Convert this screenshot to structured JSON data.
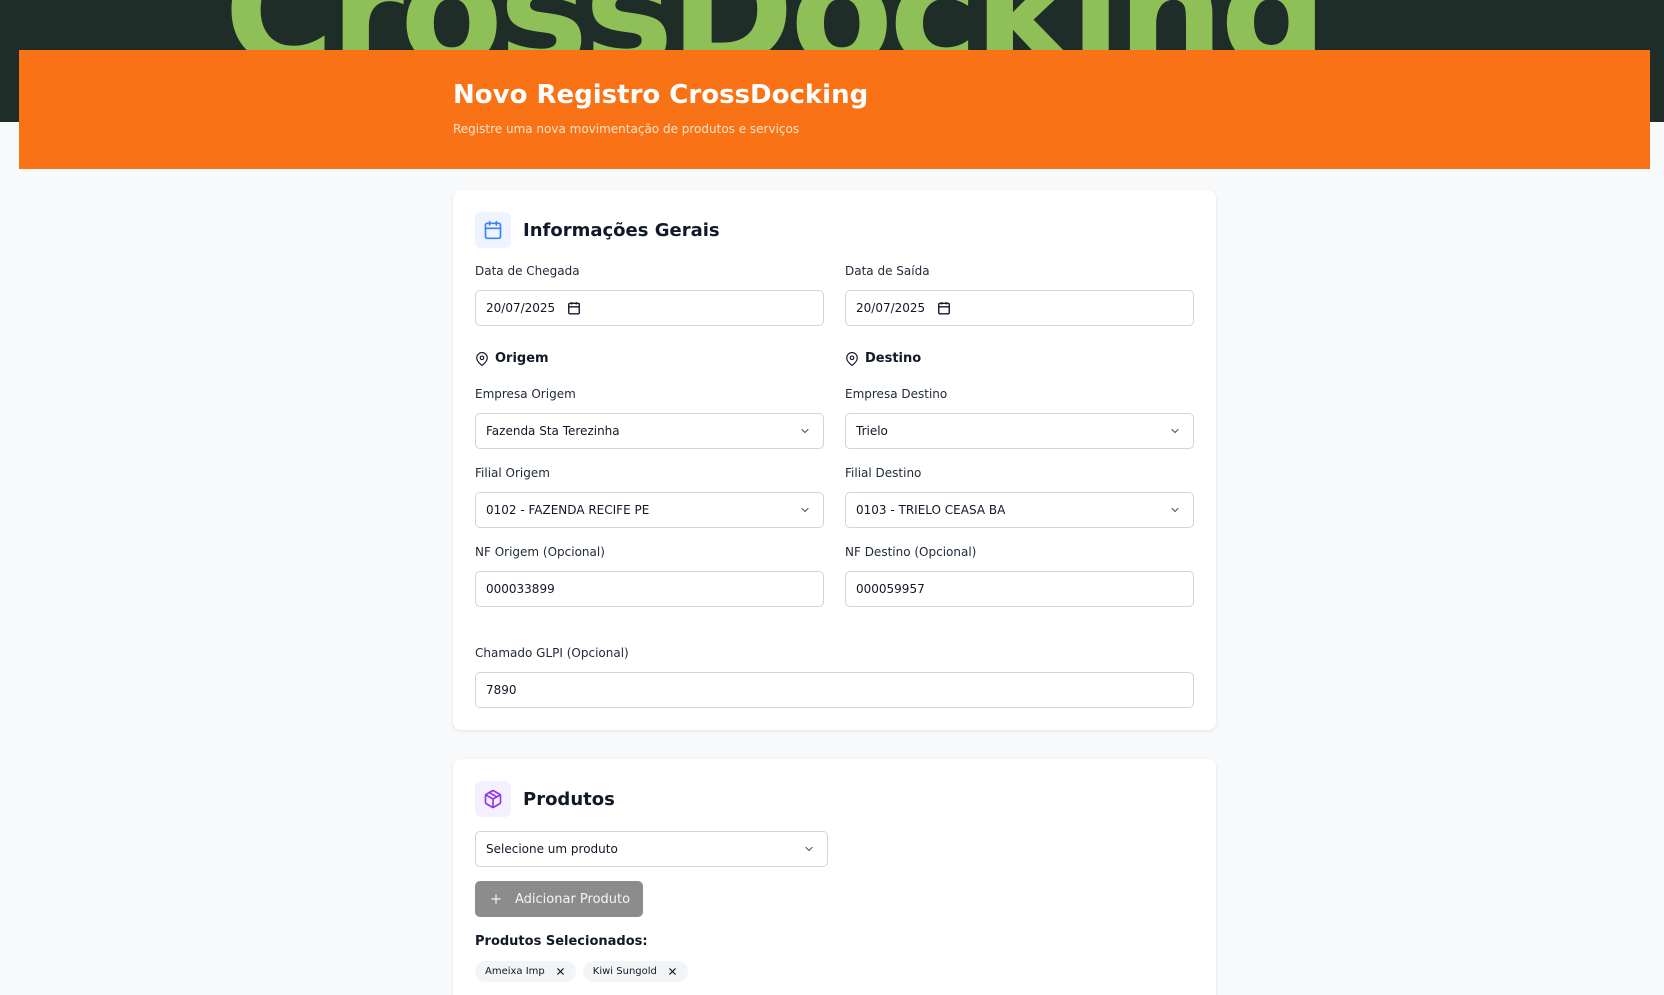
{
  "banner": {
    "bg_text": "CrossDocking"
  },
  "header": {
    "title": "Novo Registro CrossDocking",
    "subtitle": "Registre uma nova movimentação de produtos e serviços"
  },
  "general": {
    "title": "Informações Gerais",
    "arrival_label": "Data de Chegada",
    "arrival_value": "20/07/2025",
    "departure_label": "Data de Saída",
    "departure_value": "20/07/2025",
    "origin_section": "Origem",
    "destination_section": "Destino",
    "origin_company_label": "Empresa Origem",
    "origin_company_value": "Fazenda Sta Terezinha",
    "dest_company_label": "Empresa Destino",
    "dest_company_value": "Trielo",
    "origin_branch_label": "Filial Origem",
    "origin_branch_value": "0102 - FAZENDA RECIFE PE",
    "dest_branch_label": "Filial Destino",
    "dest_branch_value": "0103 - TRIELO CEASA BA",
    "origin_nf_label": "NF Origem (Opcional)",
    "origin_nf_value": "000033899",
    "dest_nf_label": "NF Destino (Opcional)",
    "dest_nf_value": "000059957",
    "ticket_label": "Chamado GLPI (Opcional)",
    "ticket_value": "7890"
  },
  "products": {
    "title": "Produtos",
    "select_placeholder": "Selecione um produto",
    "add_label": "Adicionar Produto",
    "selected_title": "Produtos Selecionados:",
    "selected": [
      "Ameixa Imp",
      "Kiwi Sungold"
    ]
  },
  "icons": {
    "general": "calendar-icon",
    "location": "map-pin-icon",
    "products": "package-icon",
    "dropdown": "chevron-down-icon",
    "add": "plus-icon",
    "remove": "close-icon"
  },
  "colors": {
    "header_bg": "#f97316",
    "banner_bg": "#1f2d29",
    "banner_text": "#8fbf57",
    "calendar_icon": "#3b82f6",
    "package_icon": "#9333ea",
    "add_button_bg": "#8c8c8c"
  }
}
